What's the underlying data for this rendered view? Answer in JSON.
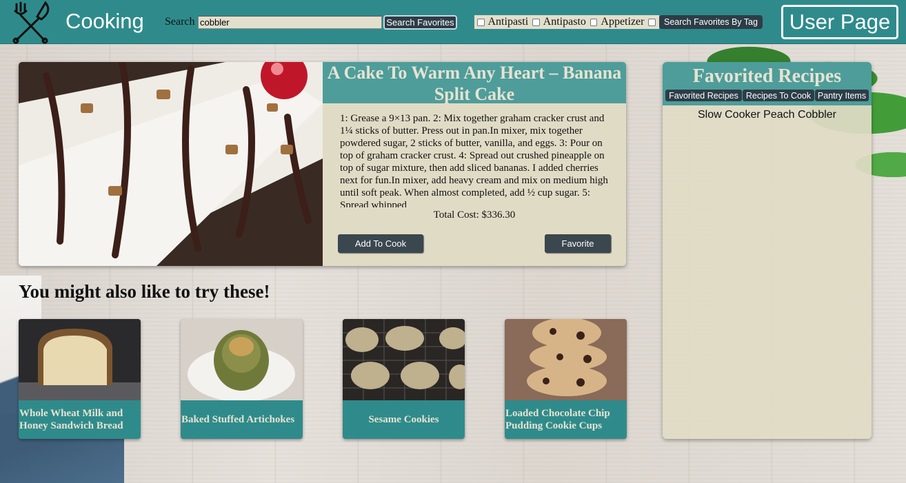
{
  "header": {
    "brand": "Cooking",
    "logo_icon": "fork-knife-icon",
    "search_label": "Search",
    "search_value": "cobbler",
    "search_button": "Search Favorites",
    "tags": [
      "Antipasti",
      "Antipasto",
      "Appetizer",
      ""
    ],
    "tag_search_button": "Search Favorites By Tag",
    "user_button": "User Page"
  },
  "feature": {
    "title": "A Cake To Warm Any Heart – Banana Split Cake",
    "steps": "1: Grease a 9×13 pan. 2: Mix together graham cracker crust and 1¼ sticks of butter. Press out in pan.In mixer, mix together powdered sugar, 2 sticks of butter, vanilla, and eggs. 3: Pour on top of graham cracker crust. 4: Spread out crushed pineapple on top of sugar mixture, then add sliced bananas. I added cherries next for fun.In mixer, add heavy cream and mix on medium high until soft peak. When almost completed, add ½ cup sugar. 5: Spread whipped",
    "cost": "Total Cost: $336.30",
    "add_to_cook": "Add To Cook",
    "favorite": "Favorite"
  },
  "suggestions": {
    "heading": "You might also like to try these!",
    "items": [
      {
        "label": "Whole Wheat Milk and Honey Sandwich Bread"
      },
      {
        "label": "Baked Stuffed Artichokes"
      },
      {
        "label": "Sesame Cookies"
      },
      {
        "label": "Loaded Chocolate Chip Pudding Cookie Cups"
      }
    ]
  },
  "favorites": {
    "title": "Favorited Recipes",
    "tabs": [
      "Favorited Recipes",
      "Recipes To Cook",
      "Pantry Items"
    ],
    "items": [
      "Slow Cooker Peach Cobbler"
    ]
  },
  "colors": {
    "header_teal": "#2f8b8b",
    "title_teal": "#4e9d9a",
    "panel_beige": "#e0dbc5",
    "dark_button": "#2d3d47"
  }
}
